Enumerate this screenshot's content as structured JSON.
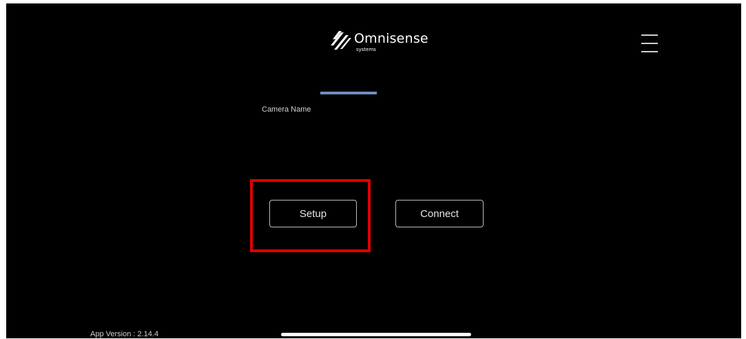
{
  "header": {
    "brand_name": "Omnisense",
    "brand_subtitle": "systems",
    "menu_icon": "hamburger-menu-icon"
  },
  "form": {
    "camera_name_label": "Camera Name"
  },
  "actions": {
    "setup_label": "Setup",
    "connect_label": "Connect"
  },
  "footer": {
    "app_version_text": "App Version : 2.14.4"
  },
  "colors": {
    "background": "#000000",
    "accent_indicator": "#6f8fc3",
    "highlight": "#e00000",
    "button_border": "#bdbdbd"
  }
}
